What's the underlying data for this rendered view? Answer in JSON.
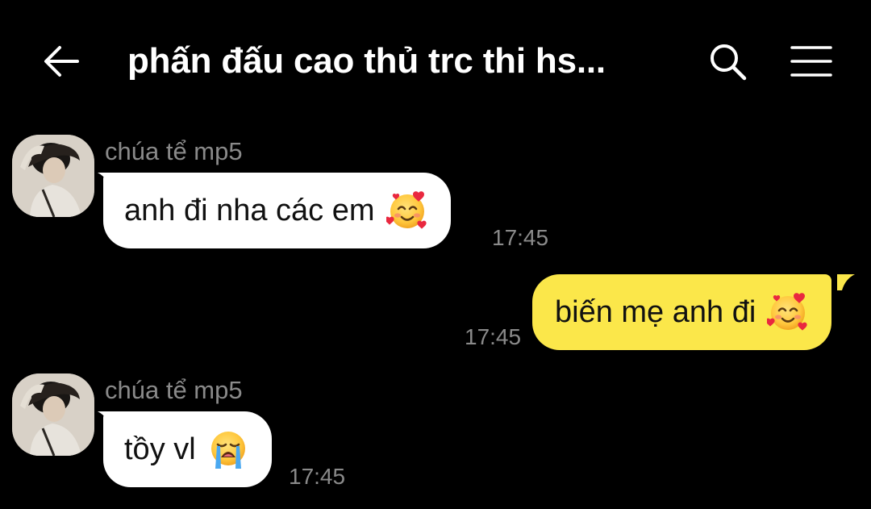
{
  "header": {
    "title": "phấn đấu cao thủ trc thi hs...",
    "back_icon": "back-arrow-icon",
    "search_icon": "search-icon",
    "menu_icon": "hamburger-menu-icon"
  },
  "colors": {
    "background": "#000000",
    "incoming_bubble": "#ffffff",
    "outgoing_bubble": "#fbe74a",
    "meta_text": "#8a8a8a"
  },
  "messages": [
    {
      "direction": "incoming",
      "sender": "chúa tể mp5",
      "text": "anh đi nha các em",
      "emoji": "smiling-face-with-hearts-icon",
      "time": "17:45"
    },
    {
      "direction": "outgoing",
      "text": "biến mẹ anh đi",
      "emoji": "smiling-face-with-hearts-icon",
      "time": "17:45"
    },
    {
      "direction": "incoming",
      "sender": "chúa tể mp5",
      "text": "tồy vl",
      "emoji": "loudly-crying-face-icon",
      "time": "17:45"
    }
  ]
}
